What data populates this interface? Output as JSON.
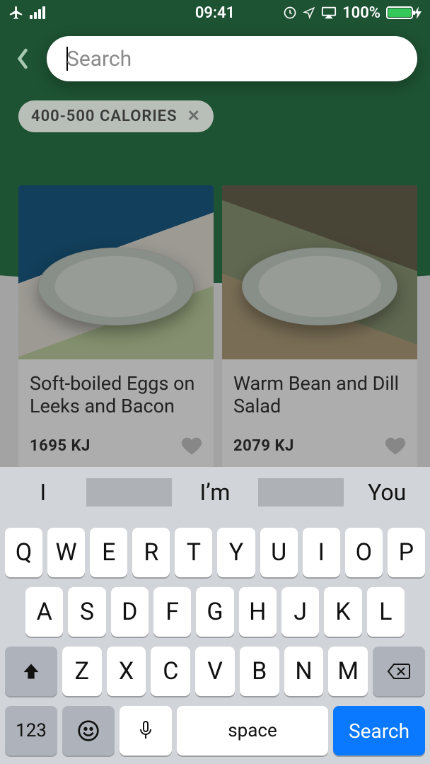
{
  "status": {
    "time": "09:41",
    "battery_pct": "100%"
  },
  "search": {
    "placeholder": "Search",
    "value": ""
  },
  "filter_chip": {
    "label": "400-500  CALORIES"
  },
  "results": [
    {
      "title": "Soft-boiled Eggs on Leeks and Bacon",
      "energy": "1695 KJ"
    },
    {
      "title": "Warm Bean and Dill Salad",
      "energy": "2079 KJ"
    }
  ],
  "keyboard": {
    "suggestions": [
      "I",
      "I’m",
      "You"
    ],
    "row1": [
      "Q",
      "W",
      "E",
      "R",
      "T",
      "Y",
      "U",
      "I",
      "O",
      "P"
    ],
    "row2": [
      "A",
      "S",
      "D",
      "F",
      "G",
      "H",
      "J",
      "K",
      "L"
    ],
    "row3": [
      "Z",
      "X",
      "C",
      "V",
      "B",
      "N",
      "M"
    ],
    "num_key": "123",
    "space_label": "space",
    "action_label": "Search"
  }
}
